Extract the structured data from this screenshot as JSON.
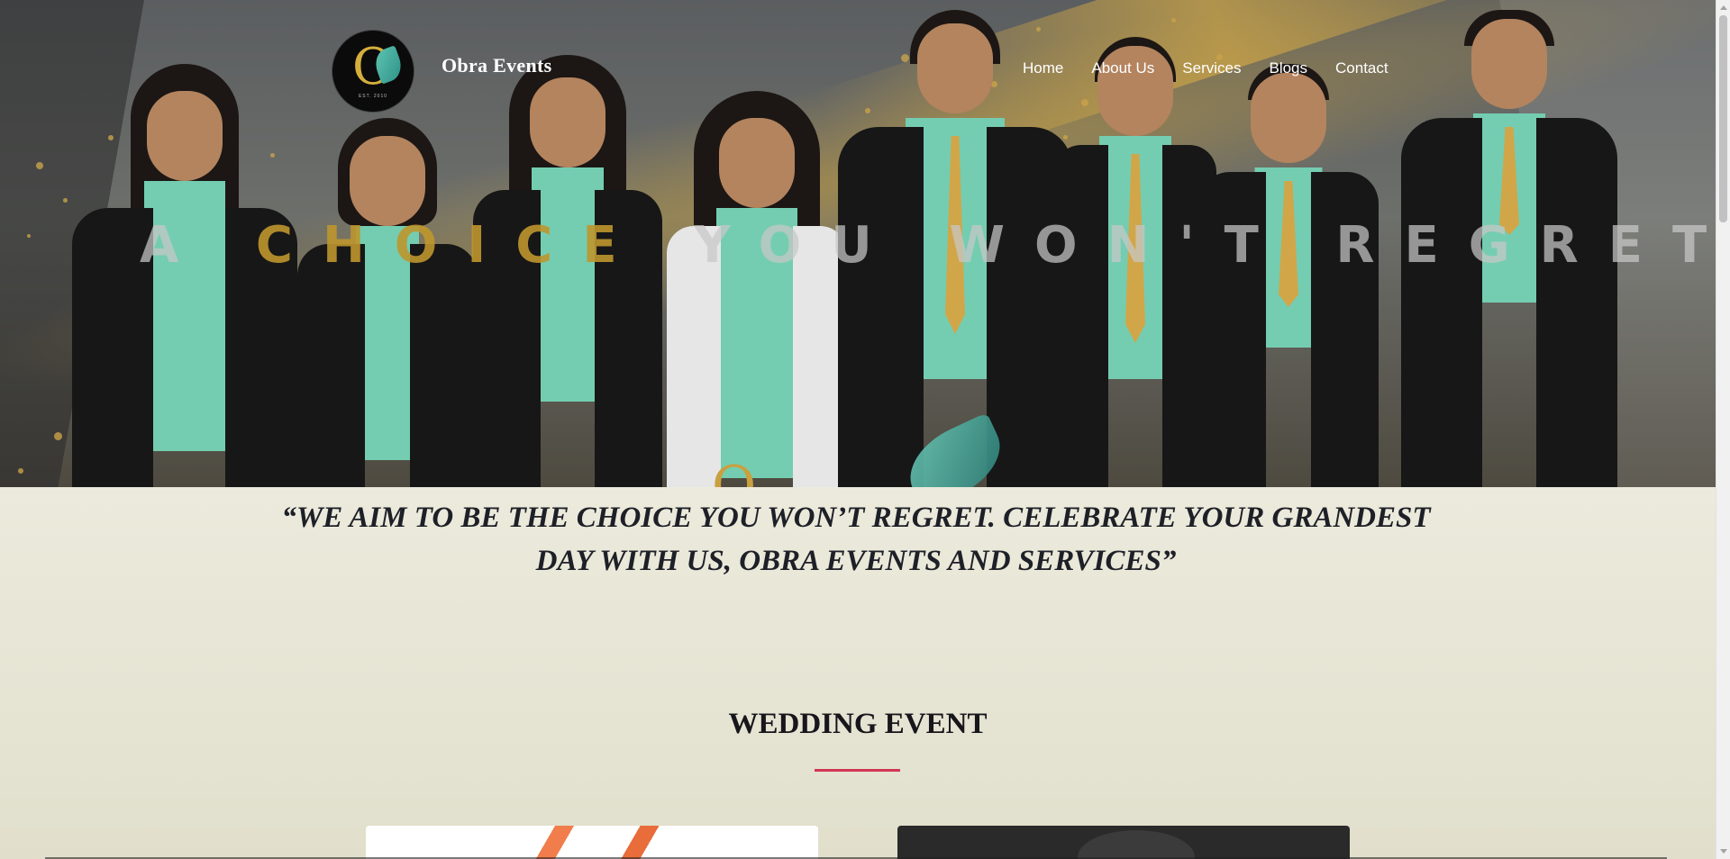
{
  "header": {
    "brand_name": "Obra Events",
    "logo_letter": "O",
    "logo_est": "EST. 2010",
    "nav": [
      {
        "label": "Home"
      },
      {
        "label": "About Us"
      },
      {
        "label": "Services"
      },
      {
        "label": "Blogs"
      },
      {
        "label": "Contact"
      }
    ]
  },
  "hero": {
    "slogan_part_1": "A ",
    "slogan_gold": "CHOICE",
    "slogan_part_2": " YOU WON'T REGRET."
  },
  "quote": {
    "text": "“WE AIM TO BE THE CHOICE YOU WON’T REGRET. CELEBRATE YOUR GRANDEST DAY WITH US, OBRA EVENTS AND SERVICES”"
  },
  "section": {
    "title": "WEDDING EVENT"
  },
  "colors": {
    "accent_rule": "#d23655",
    "gold": "#c9a24a",
    "mint_shirt": "#74cdb1",
    "page_bg": "#e7e6d6"
  },
  "icons": [
    "logo-icon",
    "scroll-up-arrow-icon",
    "scroll-down-arrow-icon"
  ]
}
